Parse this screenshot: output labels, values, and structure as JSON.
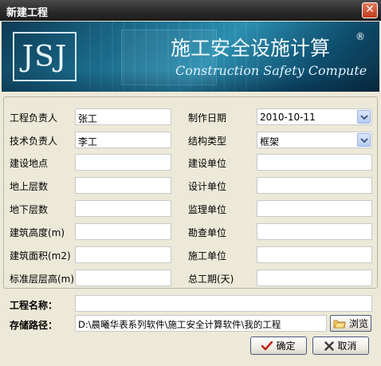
{
  "window": {
    "title": "新建工程",
    "close_glyph": "✕"
  },
  "banner": {
    "logo_text": "JSJ",
    "cn_title": "施工安全设施计算",
    "registered_mark": "®",
    "en_title": "Construction Safety Compute"
  },
  "form": {
    "project_manager": {
      "label": "工程负责人",
      "value": "张工"
    },
    "tech_manager": {
      "label": "技术负责人",
      "value": "李工"
    },
    "build_location": {
      "label": "建设地点",
      "value": ""
    },
    "floors_above": {
      "label": "地上层数",
      "value": ""
    },
    "floors_below": {
      "label": "地下层数",
      "value": ""
    },
    "building_height": {
      "label": "建筑高度(m)",
      "value": ""
    },
    "building_area": {
      "label": "建筑面积(m2)",
      "value": ""
    },
    "std_floor_height": {
      "label": "标准层层高(m)",
      "value": ""
    },
    "creation_date": {
      "label": "制作日期",
      "value": "2010-10-11"
    },
    "structure_type": {
      "label": "结构类型",
      "value": "框架"
    },
    "construction_unit": {
      "label": "建设单位",
      "value": ""
    },
    "design_unit": {
      "label": "设计单位",
      "value": ""
    },
    "supervision_unit": {
      "label": "监理单位",
      "value": ""
    },
    "survey_unit": {
      "label": "勘查单位",
      "value": ""
    },
    "builder_unit": {
      "label": "施工单位",
      "value": ""
    },
    "total_duration": {
      "label": "总工期(天)",
      "value": ""
    }
  },
  "project_name": {
    "label": "工程名称：",
    "value": ""
  },
  "storage_path": {
    "label": "存储路径：",
    "value": "D:\\晨曦华表系列软件\\施工安全计算软件\\我的工程"
  },
  "buttons": {
    "browse": "浏览",
    "ok": "确定",
    "cancel": "取消"
  },
  "colors": {
    "title_bar": "#2a2a2a",
    "banner": "#1a6a8a",
    "dialog_bg": "#ece9d8"
  }
}
